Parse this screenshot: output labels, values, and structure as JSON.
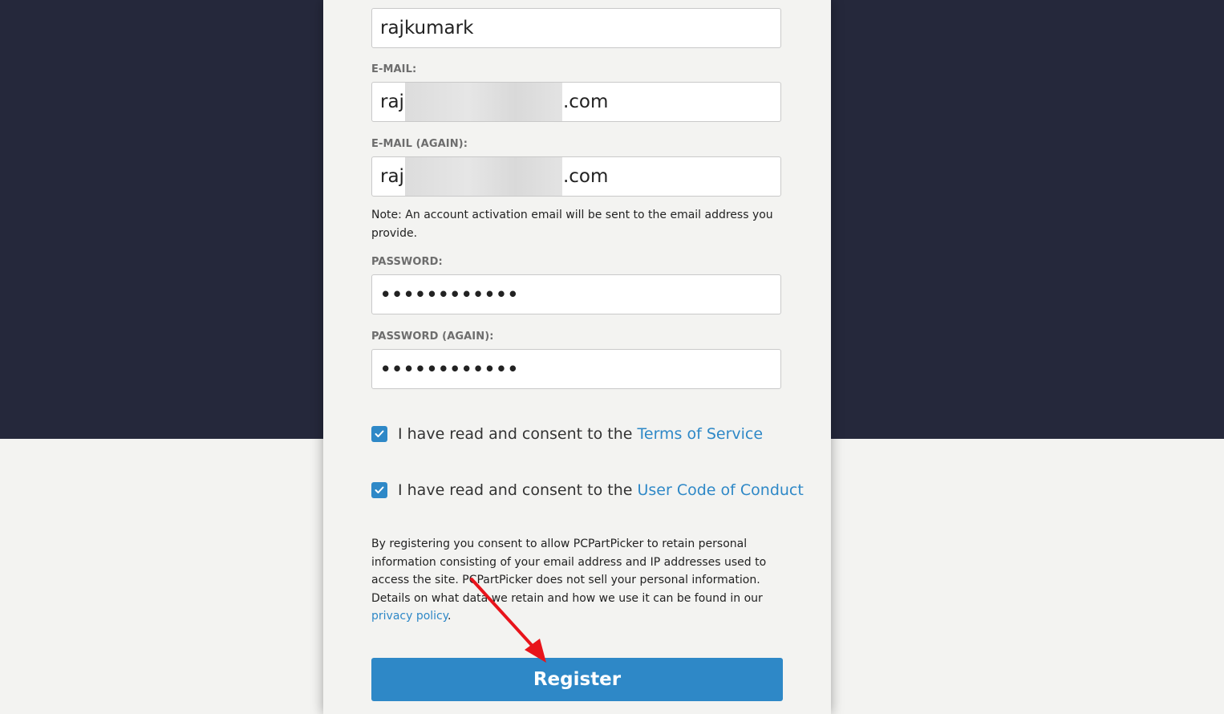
{
  "form": {
    "username_value": "rajkumark",
    "email_label": "E-MAIL:",
    "email_prefix": "raj",
    "email_suffix": ".com",
    "email_again_label": "E-MAIL (AGAIN):",
    "email_again_prefix": "raj",
    "email_again_suffix": ".com",
    "note": "Note: An account activation email will be sent to the email address you provide.",
    "password_label": "PASSWORD:",
    "password_value": "••••••••••••",
    "password_again_label": "PASSWORD (AGAIN):",
    "password_again_value": "••••••••••••",
    "consent_text": "I have read and consent to the",
    "terms_link": "Terms of Service",
    "conduct_link": "User Code of Conduct",
    "privacy_text": "By registering you consent to allow PCPartPicker to retain personal information consisting of your email address and IP addresses used to access the site. PCPartPicker does not sell your personal information. Details on what data we retain and how we use it can be found in our",
    "privacy_link": "privacy policy",
    "privacy_end": ".",
    "register_label": "Register"
  },
  "colors": {
    "header_bg": "#25283b",
    "page_bg": "#f3f3f1",
    "accent": "#2e88c7",
    "annotation_arrow": "#e8141b"
  },
  "icons": {
    "checkbox": "check-icon"
  }
}
